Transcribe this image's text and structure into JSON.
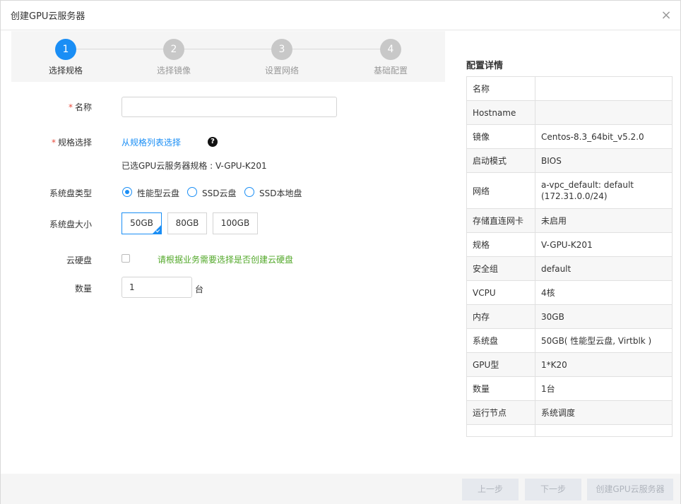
{
  "dialog": {
    "title": "创建GPU云服务器",
    "close_glyph": "×"
  },
  "steps": [
    {
      "number": "1",
      "label": "选择规格",
      "active": true
    },
    {
      "number": "2",
      "label": "选择镜像",
      "active": false
    },
    {
      "number": "3",
      "label": "设置网络",
      "active": false
    },
    {
      "number": "4",
      "label": "基础配置",
      "active": false
    }
  ],
  "form": {
    "required_mark": "*",
    "name": {
      "label": "名称",
      "value": "",
      "placeholder": ""
    },
    "spec": {
      "label": "规格选择",
      "link": "从规格列表选择",
      "help_glyph": "?",
      "selected_text": "已选GPU云服务器规格 : V-GPU-K201"
    },
    "disk_type": {
      "label": "系统盘类型",
      "options": [
        "性能型云盘",
        "SSD云盘",
        "SSD本地盘"
      ],
      "selected": "性能型云盘"
    },
    "disk_size": {
      "label": "系统盘大小",
      "options": [
        "50GB",
        "80GB",
        "100GB"
      ],
      "selected": "50GB"
    },
    "cloud_disk": {
      "label": "云硬盘",
      "checked": false,
      "hint": "请根据业务需要选择是否创建云硬盘"
    },
    "quantity": {
      "label": "数量",
      "value": "1",
      "unit": "台"
    }
  },
  "details": {
    "title": "配置详情",
    "rows": [
      {
        "key": "名称",
        "value": ""
      },
      {
        "key": "Hostname",
        "value": ""
      },
      {
        "key": "镜像",
        "value": "Centos-8.3_64bit_v5.2.0"
      },
      {
        "key": "启动模式",
        "value": "BIOS"
      },
      {
        "key": "网络",
        "value": "a-vpc_default: default (172.31.0.0/24)"
      },
      {
        "key": "存储直连网卡",
        "value": "未启用"
      },
      {
        "key": "规格",
        "value": "V-GPU-K201"
      },
      {
        "key": "安全组",
        "value": "default"
      },
      {
        "key": "VCPU",
        "value": "4核"
      },
      {
        "key": "内存",
        "value": "30GB"
      },
      {
        "key": "系统盘",
        "value": "50GB( 性能型云盘, Virtblk )"
      },
      {
        "key": "GPU型",
        "value": "1*K20"
      },
      {
        "key": "数量",
        "value": "1台"
      },
      {
        "key": "运行节点",
        "value": "系统调度"
      }
    ]
  },
  "footer": {
    "prev_label": "上一步",
    "next_label": "下一步",
    "create_label": "创建GPU云服务器"
  },
  "colors": {
    "accent": "#1a8ef5",
    "required": "#e84c3d",
    "hint_green": "#52a829",
    "disabled_button_bg": "#e6e9ee"
  }
}
